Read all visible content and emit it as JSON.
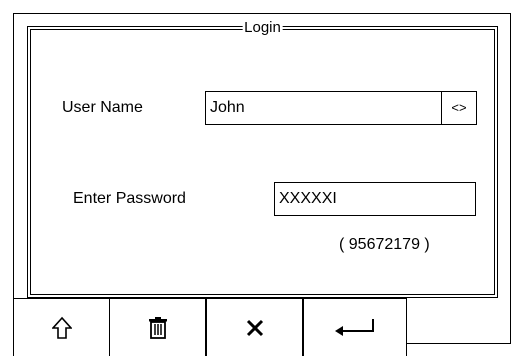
{
  "dialog": {
    "title": "Login",
    "user_name_label": "User Name",
    "user_name_value": "John",
    "user_toggle_label": "<>",
    "password_label": "Enter Password",
    "password_value": "XXXXXI",
    "code_display": "( 95672179 )"
  },
  "toolbar": {
    "buttons": [
      {
        "icon": "shift-up-arrow-icon"
      },
      {
        "icon": "trash-icon"
      },
      {
        "icon": "close-x-icon"
      },
      {
        "icon": "enter-return-icon"
      }
    ]
  }
}
